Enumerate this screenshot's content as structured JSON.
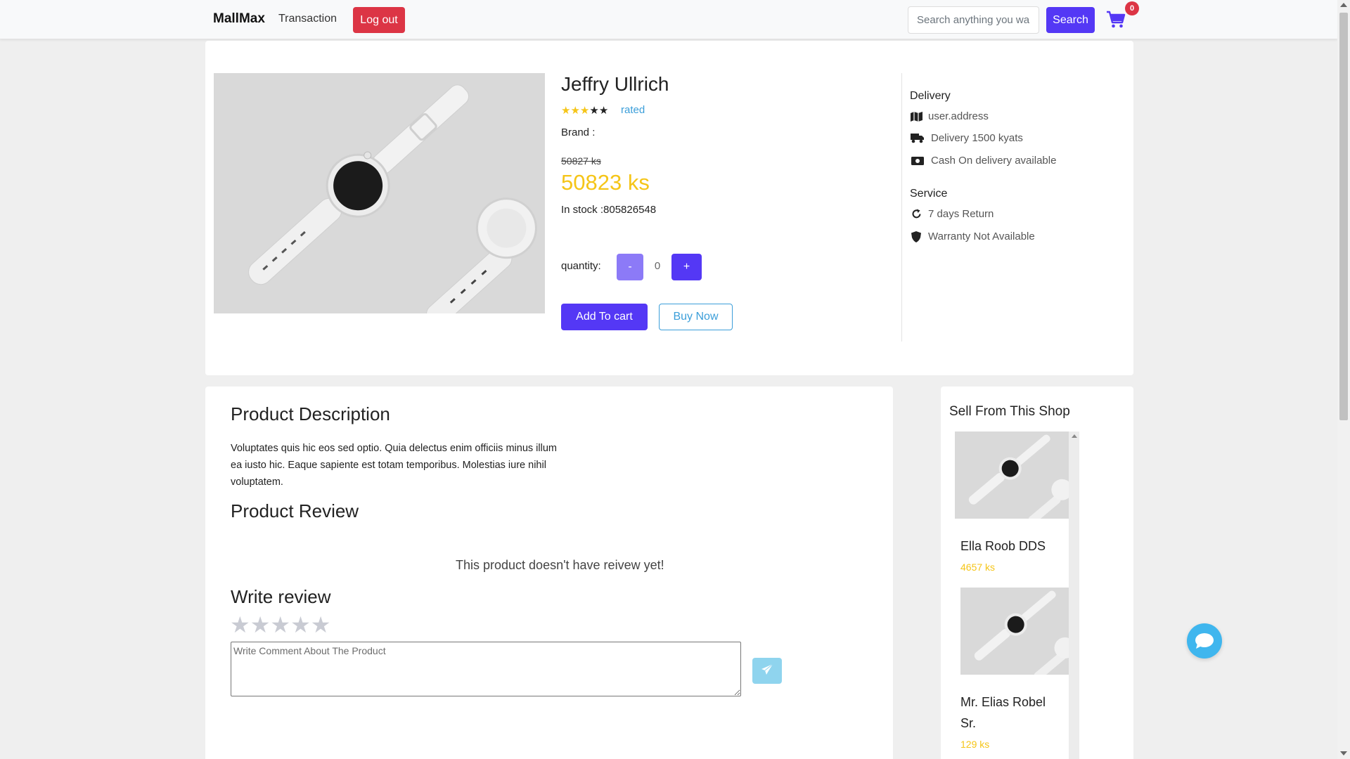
{
  "nav": {
    "brand": "MallMax",
    "transaction": "Transaction",
    "logout": "Log out",
    "search_placeholder": "Search anything you wa",
    "search_label": "Search",
    "cart_count": "0"
  },
  "product": {
    "title": "Jeffry Ullrich",
    "rating": 3,
    "rating_max": 5,
    "rated_label": "rated",
    "brand_label": "Brand :",
    "old_price": "50827 ks",
    "price": "50823 ks",
    "stock": "In stock :805826548",
    "quantity_label": "quantity:",
    "quantity_minus": "-",
    "quantity_value": "0",
    "quantity_plus": "+",
    "add_to_cart": "Add To cart",
    "buy_now": "Buy Now"
  },
  "delivery": {
    "heading": "Delivery",
    "address": "user.address",
    "fee": "Delivery 1500 kyats",
    "cod": "Cash On delivery available"
  },
  "service": {
    "heading": "Service",
    "return": "7 days Return",
    "warranty": "Warranty Not Available"
  },
  "description": {
    "heading": "Product Description",
    "text": "Voluptates quis hic eos sed optio. Quia delectus enim officiis minus illum ea iusto hic. Eaque sapiente est totam temporibus. Molestias iure nihil voluptatem."
  },
  "review": {
    "heading": "Product Review",
    "empty": "This product doesn't have reivew yet!",
    "write_heading": "Write review",
    "comment_placeholder": "Write Comment About The Product"
  },
  "shop": {
    "heading": "Sell From This Shop",
    "items": [
      {
        "name": "Ella Roob DDS",
        "price": "4657 ks"
      },
      {
        "name": "Mr. Elias Robel Sr.",
        "price": "129 ks"
      }
    ]
  },
  "colors": {
    "primary": "#5438f5",
    "danger": "#dc3545",
    "price": "#f5c518",
    "link": "#3b9ed9",
    "chat": "#3fb6ee"
  }
}
